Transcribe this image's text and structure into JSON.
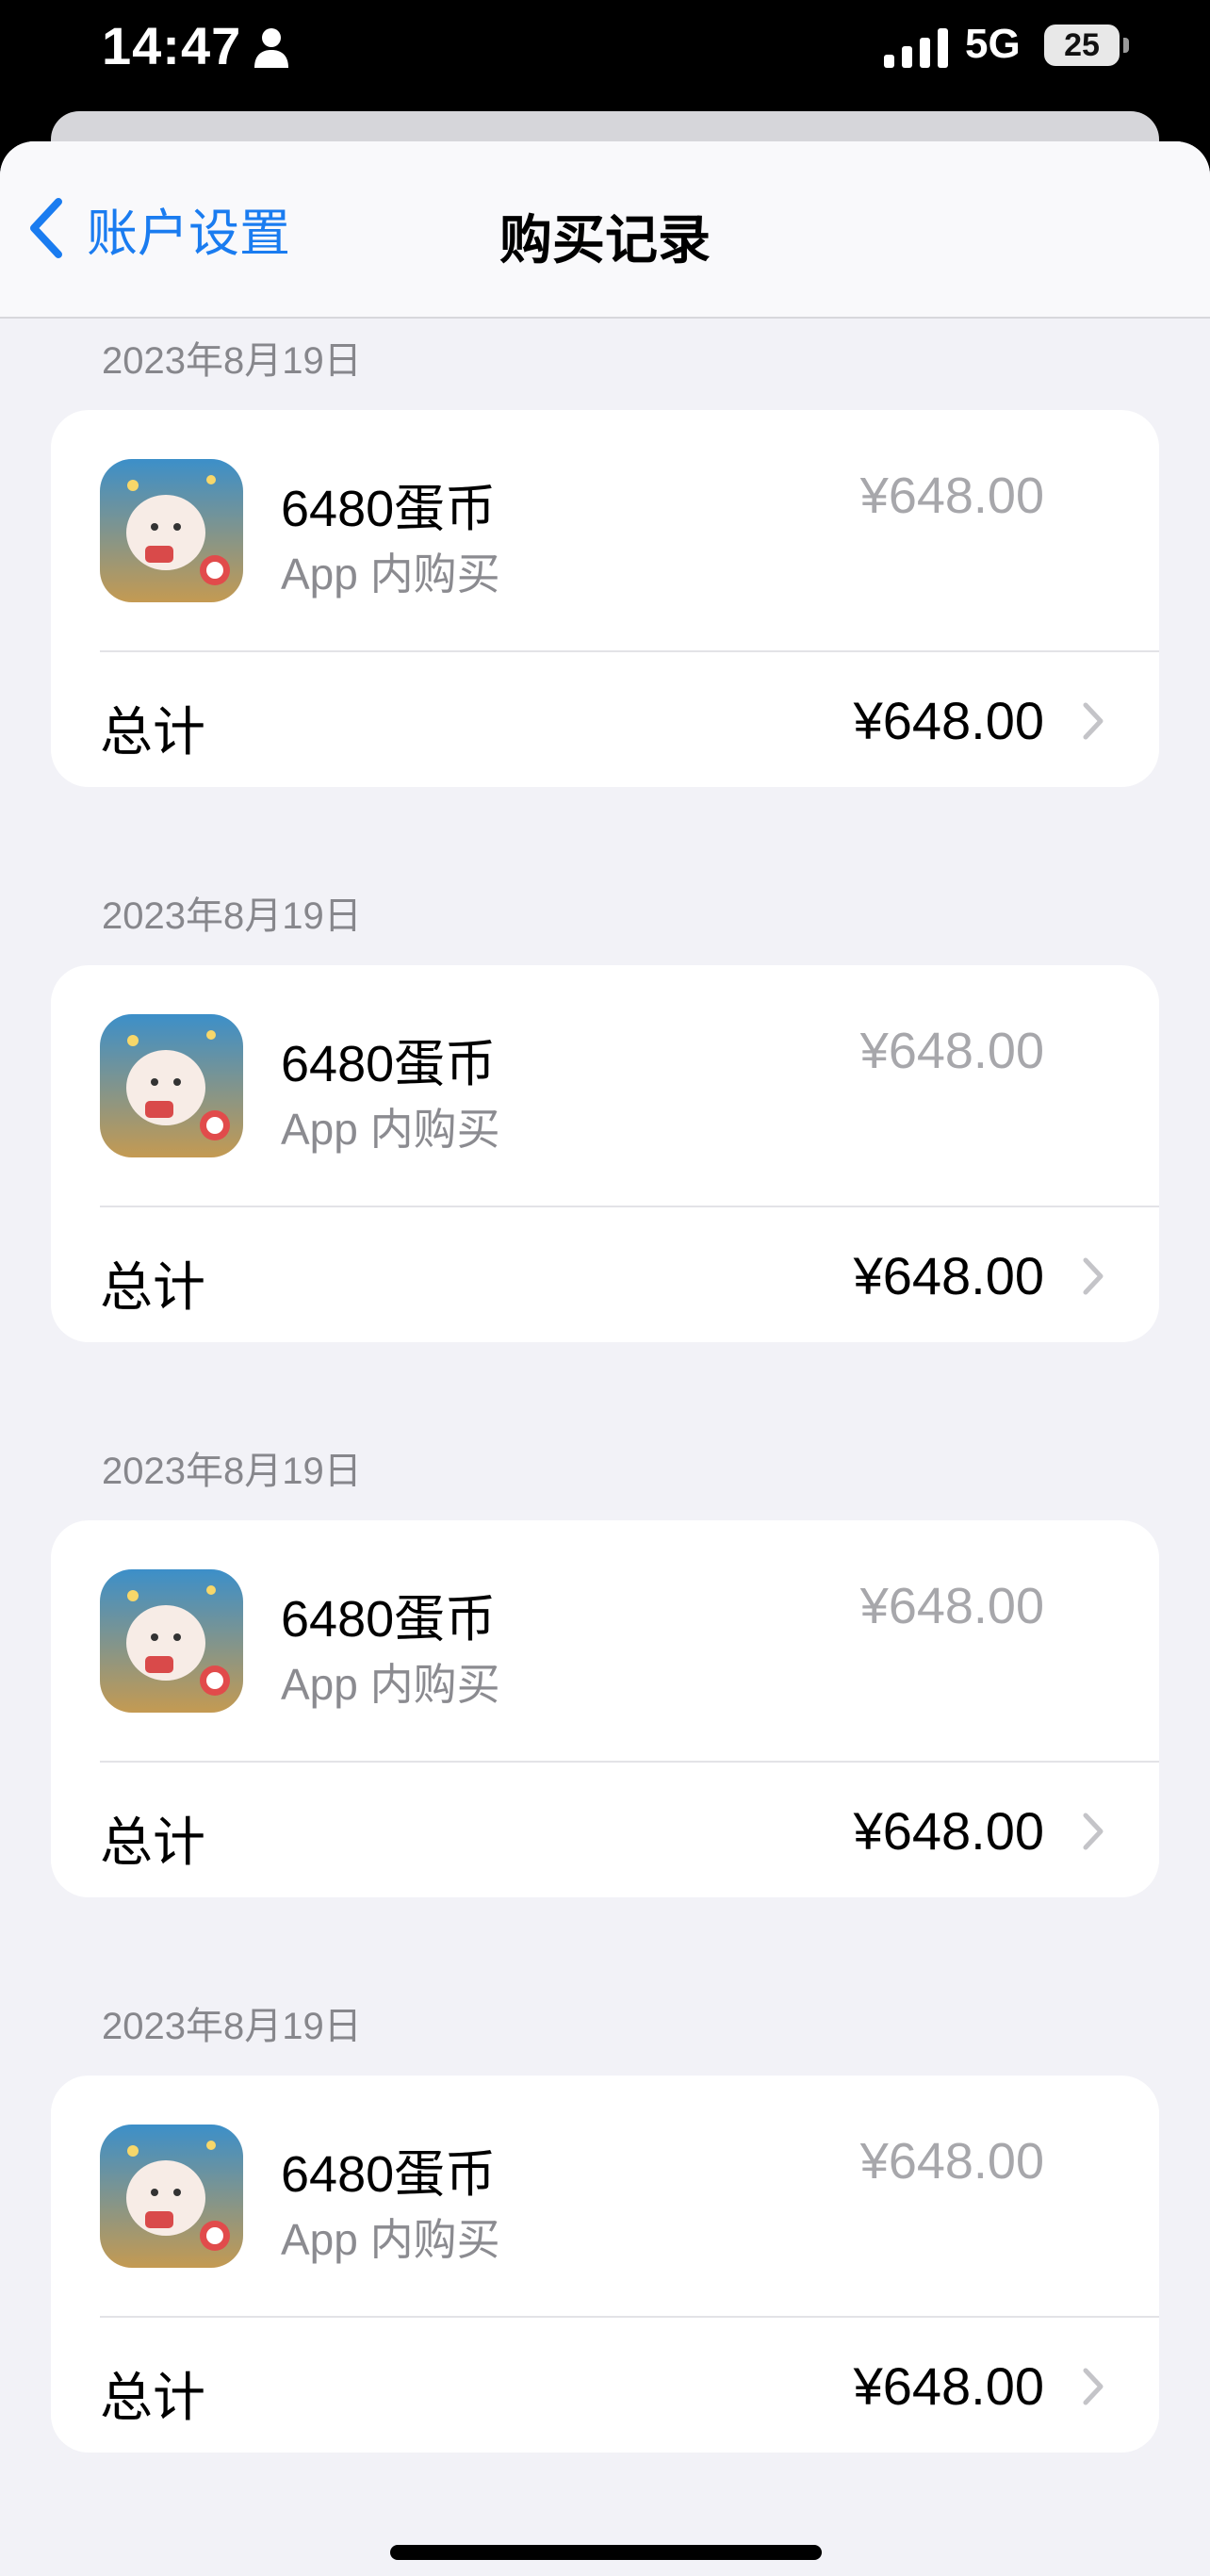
{
  "status_bar": {
    "time": "14:47",
    "network": "5G",
    "battery": "25",
    "icons": [
      "person-icon",
      "signal-icon",
      "battery-icon"
    ]
  },
  "nav": {
    "back_label": "账户设置",
    "title": "购买记录",
    "back_icon": "chevron-left-icon",
    "accent_color": "#1a7cf0"
  },
  "purchases": [
    {
      "date": "2023年8月19日",
      "item_name": "6480蛋币",
      "item_type": "App 内购买",
      "item_price": "¥648.00",
      "total_label": "总计",
      "total_value": "¥648.00"
    },
    {
      "date": "2023年8月19日",
      "item_name": "6480蛋币",
      "item_type": "App 内购买",
      "item_price": "¥648.00",
      "total_label": "总计",
      "total_value": "¥648.00"
    },
    {
      "date": "2023年8月19日",
      "item_name": "6480蛋币",
      "item_type": "App 内购买",
      "item_price": "¥648.00",
      "total_label": "总计",
      "total_value": "¥648.00"
    },
    {
      "date": "2023年8月19日",
      "item_name": "6480蛋币",
      "item_type": "App 内购买",
      "item_price": "¥648.00",
      "total_label": "总计",
      "total_value": "¥648.00"
    }
  ]
}
